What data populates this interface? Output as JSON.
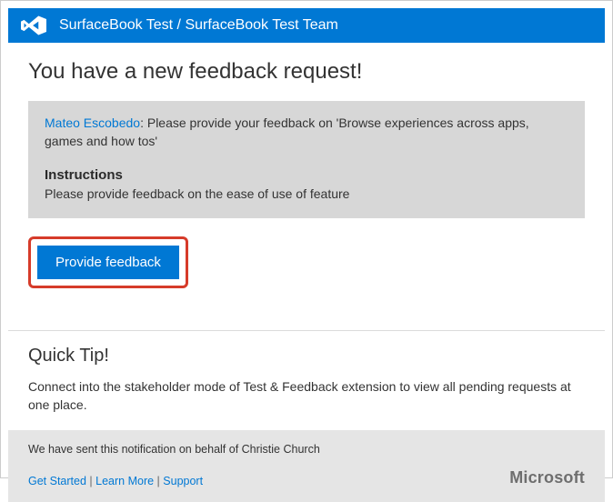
{
  "header": {
    "title": "SurfaceBook Test / SurfaceBook Test Team"
  },
  "main": {
    "title": "You have a new feedback request!",
    "requester_name": "Mateo Escobedo",
    "request_prefix": ": Please provide your feedback on 'Browse experiences across  apps, games and how tos'",
    "instructions_heading": "Instructions",
    "instructions_text": "Please provide feedback on the ease of use of feature",
    "cta_label": "Provide feedback"
  },
  "tip": {
    "title": "Quick Tip!",
    "body": "Connect into the stakeholder mode of Test & Feedback extension to view all pending requests at one place."
  },
  "footer": {
    "sent_prefix": "We have sent this notification on behalf of ",
    "sent_name": "Christie Church",
    "links": {
      "get_started": "Get Started",
      "learn_more": "Learn More",
      "support": "Support"
    },
    "separator": " | ",
    "brand": "Microsoft"
  },
  "colors": {
    "accent": "#0078d4",
    "highlight_border": "#d63b2a"
  }
}
